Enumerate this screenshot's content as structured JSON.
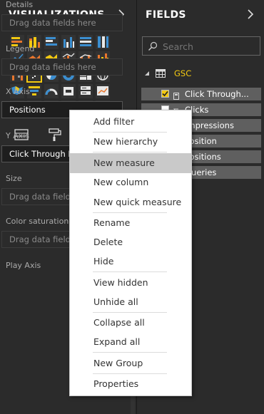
{
  "visualizations": {
    "title": "VISUALIZATIONS",
    "icons": [
      [
        "stacked-bar-chart-icon",
        "stacked-column-chart-icon",
        "clustered-bar-chart-icon",
        "clustered-column-chart-icon",
        "100-stacked-bar-chart-icon",
        "100-stacked-column-chart-icon"
      ],
      [
        "line-chart-icon",
        "area-chart-icon",
        "stacked-area-chart-icon",
        "line-and-column-chart-icon",
        "line-and-clustered-column-chart-icon",
        "ribbon-chart-icon"
      ],
      [
        "waterfall-chart-icon",
        "scatter-chart-icon",
        "pie-chart-icon",
        "donut-chart-icon",
        "treemap-icon",
        "map-icon"
      ],
      [
        "filled-map-icon",
        "funnel-icon",
        "gauge-icon",
        "card-icon",
        "multi-row-card-icon",
        "kpi-icon"
      ],
      [
        "slicer-icon",
        "table-icon",
        "matrix-icon",
        "r-visual-icon",
        "globe-icon",
        "more-icon"
      ]
    ],
    "selected_icon": "scatter-chart-icon",
    "tabs": [
      "fields-tab-icon",
      "format-paint-roller-icon"
    ],
    "wells": [
      {
        "label": "Details",
        "value": "Drag data fields here"
      },
      {
        "label": "Legend",
        "value": "Drag data fields here"
      },
      {
        "label": "X Axis",
        "value": "Positions"
      },
      {
        "label": "Y Axis",
        "value": "Click Through Rate"
      },
      {
        "label": "Size",
        "value": "Drag data fields here"
      },
      {
        "label": "Color saturation",
        "value": "Drag data fields here"
      },
      {
        "label": "Play Axis",
        "value": ""
      }
    ]
  },
  "fields": {
    "title": "FIELDS",
    "search_placeholder": "Search",
    "table_name": "GSC",
    "items": [
      "Click Through...",
      "Clicks",
      "Impressions",
      "Position",
      "Positions",
      "Queries"
    ]
  },
  "context_menu": {
    "items": [
      "Add filter",
      "New hierarchy",
      "New measure",
      "New column",
      "New quick measure",
      "Rename",
      "Delete",
      "Hide",
      "View hidden",
      "Unhide all",
      "Collapse all",
      "Expand all",
      "New Group",
      "Properties"
    ],
    "highlighted": "New measure"
  },
  "colors": {
    "accent": "#f2c811",
    "panel": "#2b2b2b",
    "field_row": "#5f5f5f",
    "menu_highlight": "#c9c9c9",
    "viz_blue": "#3b8ed0",
    "viz_orange": "#e8762d"
  }
}
